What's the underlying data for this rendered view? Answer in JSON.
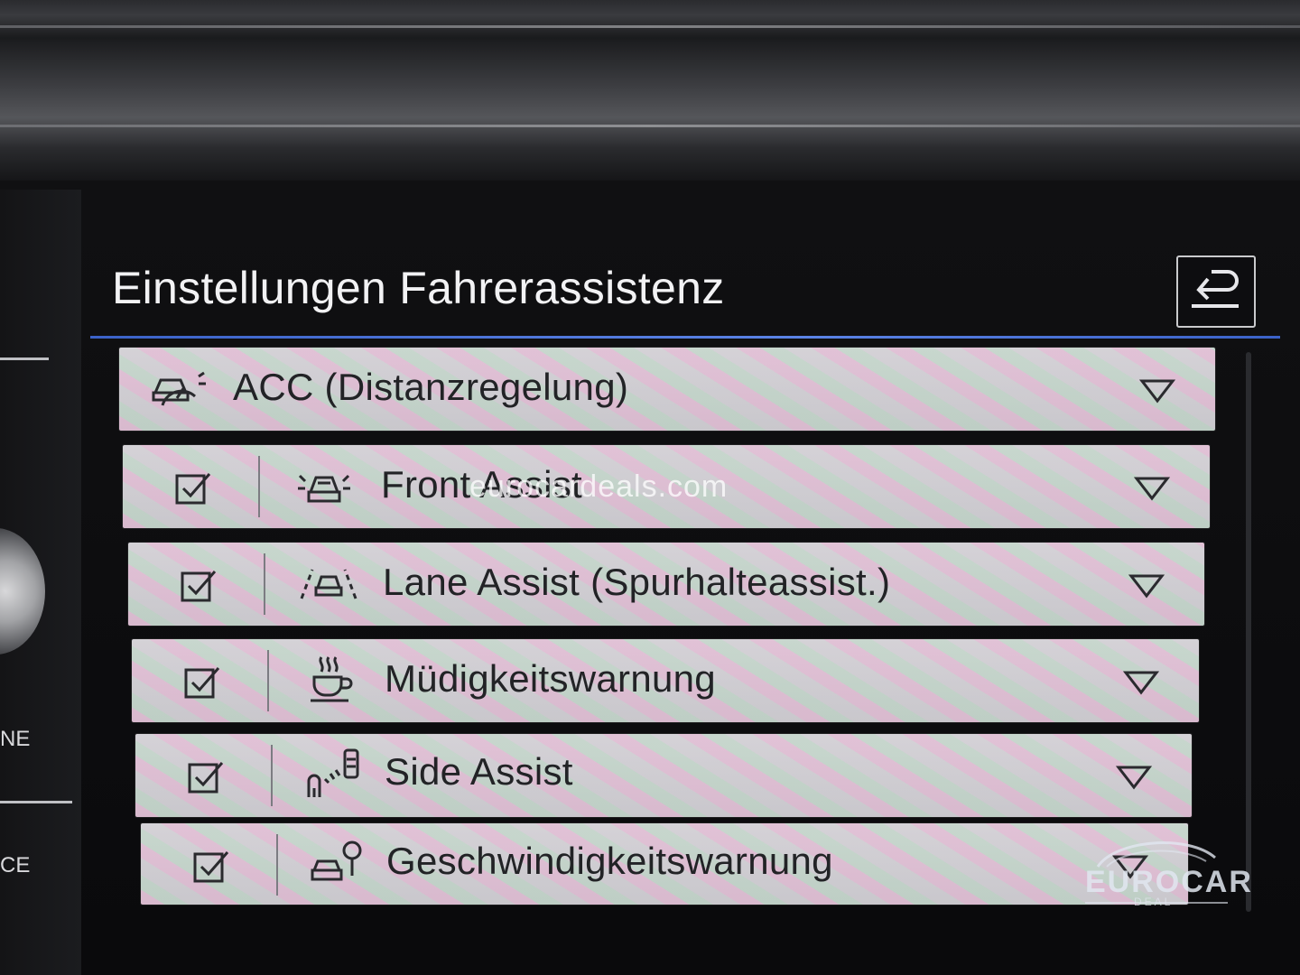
{
  "header": {
    "title": "Einstellungen Fahrerassistenz"
  },
  "back_button": {
    "icon": "back-arrow-icon"
  },
  "left_panel": {
    "labels": [
      "NE",
      "CE"
    ]
  },
  "menu": {
    "items": [
      {
        "label": "ACC (Distanzregelung)",
        "icon": "acc-distance-icon",
        "has_checkbox": false,
        "checked": null,
        "expand_icon": "chevron-down-icon"
      },
      {
        "label": "Front Assist",
        "icon": "front-assist-icon",
        "has_checkbox": true,
        "checked": true,
        "expand_icon": "chevron-down-icon"
      },
      {
        "label": "Lane Assist (Spurhalteassist.)",
        "icon": "lane-assist-icon",
        "has_checkbox": true,
        "checked": true,
        "expand_icon": "chevron-down-icon"
      },
      {
        "label": "Müdigkeitswarnung",
        "icon": "coffee-cup-icon",
        "has_checkbox": true,
        "checked": true,
        "expand_icon": "chevron-down-icon"
      },
      {
        "label": "Side Assist",
        "icon": "side-assist-icon",
        "has_checkbox": true,
        "checked": true,
        "expand_icon": "chevron-down-icon"
      },
      {
        "label": "Geschwindigkeitswarnung",
        "icon": "speed-warning-icon",
        "has_checkbox": true,
        "checked": true,
        "expand_icon": "chevron-down-icon"
      }
    ]
  },
  "overlay": {
    "watermark_text": "eurocardeals.com",
    "logo_text": "EUROCAR",
    "logo_subtext": "DEAL"
  },
  "colors": {
    "accent_rule": "#4a72d8",
    "item_bg": "#cfcdd2",
    "text_dark": "#222326"
  }
}
